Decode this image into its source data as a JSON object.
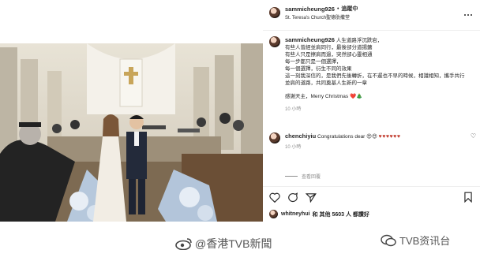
{
  "post": {
    "header": {
      "username": "sammicheung926",
      "follow_label": "追蹤中",
      "location": "St. Teresa's Church聖德肋撒堂"
    },
    "caption": {
      "username": "sammicheung926",
      "lines": [
        "人生道路浮沉跌宕，",
        "有些人曾經並肩同行，最後卻分道揚鑣",
        "有些人只是擦肩而過，突然卻心靈相通",
        "每一步都只是一個選擇，",
        "每一個選擇，衍生不同的效果",
        "這一刻我深信的，是我們先後轉折，在不遲也不早的時候，相識相知，攜手共行並肩的道路，共同奠基人生新的一章"
      ],
      "closing": "感謝天主，Merry Christmas",
      "emoji": "❤️🎄",
      "timestamp": "10 小時"
    },
    "comment": {
      "username": "chenchiyiu",
      "text": "Congratulations dear",
      "emoji": "😍😍",
      "hearts": "♥♥♥♥♥♥",
      "timestamp": "10 小時"
    },
    "view_replies_label": "查看回覆",
    "likes": {
      "liker": "whitneyhui",
      "count_text": "和 其他 5603 人 都讚好"
    }
  },
  "watermarks": {
    "left": "@香港TVB新聞",
    "right": "TVB资讯台"
  },
  "colors": {
    "icon_dark": "#262626",
    "secondary_text": "#8e8e8e",
    "heart_red": "#c0392b"
  }
}
